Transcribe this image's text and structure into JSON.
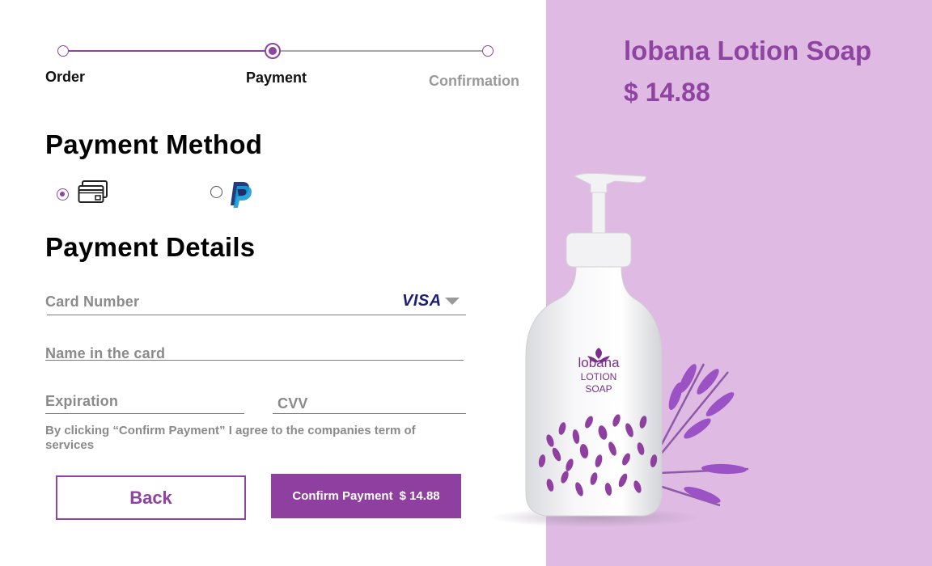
{
  "stepper": {
    "steps": [
      {
        "label": "Order",
        "state": "done"
      },
      {
        "label": "Payment",
        "state": "active"
      },
      {
        "label": "Confirmation",
        "state": "upcoming"
      }
    ]
  },
  "payment_method": {
    "heading": "Payment Method",
    "options": [
      {
        "icon": "credit-card-icon",
        "selected": true
      },
      {
        "icon": "paypal-icon",
        "selected": false
      }
    ]
  },
  "payment_details": {
    "heading": "Payment Details",
    "card_number": {
      "placeholder": "Card Number",
      "value": "",
      "brand": "VISA"
    },
    "name": {
      "placeholder": "Name in the card",
      "value": ""
    },
    "expiration": {
      "placeholder": "Expiration",
      "value": ""
    },
    "cvv": {
      "placeholder": "CVV",
      "value": ""
    },
    "terms": "By clicking “Confirm Payment” I agree to the companies term of services"
  },
  "actions": {
    "back_label": "Back",
    "confirm_label": "Confirm Payment",
    "confirm_price": "$ 14.88"
  },
  "product": {
    "name": "lobana Lotion Soap",
    "price": "$ 14.88",
    "label_brand": "lobana",
    "label_line1": "LOTION",
    "label_line2": "SOAP"
  },
  "colors": {
    "accent": "#8e44a0",
    "panel": "#dfbae3",
    "muted": "#8a8a8a"
  }
}
